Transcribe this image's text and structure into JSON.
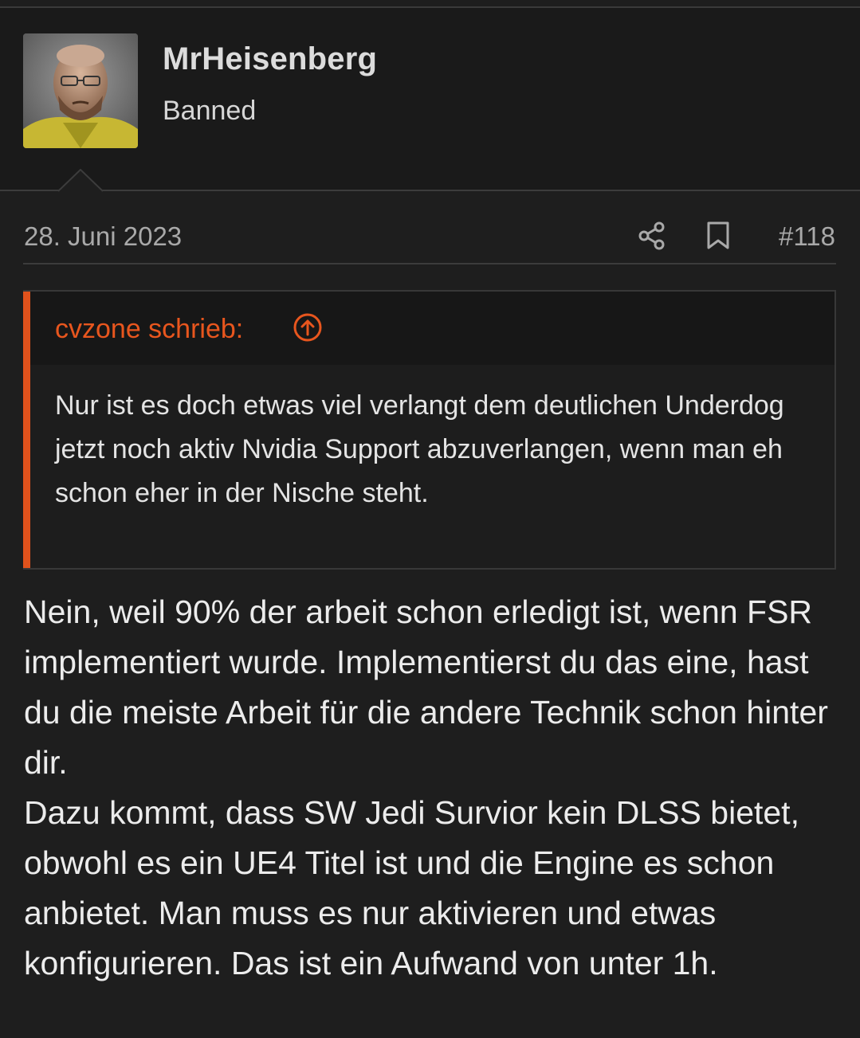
{
  "user": {
    "name": "MrHeisenberg",
    "title": "Banned",
    "avatar_icon": "portrait-avatar"
  },
  "post": {
    "date": "28. Juni 2023",
    "number": "#118",
    "share_icon": "share-icon",
    "bookmark_icon": "bookmark-icon"
  },
  "quote": {
    "author": "cvzone schrieb:",
    "jump_icon": "arrow-up-circle-icon",
    "text": "Nur ist es doch etwas viel verlangt dem deutlichen Underdog jetzt noch aktiv Nvidia Support abzuverlangen, wenn man eh schon eher in der Nische steht."
  },
  "body": {
    "paragraph1": "Nein, weil 90% der arbeit schon erledigt ist, wenn FSR implementiert wurde. Implementierst du das eine, hast du die meiste Arbeit für die andere Technik schon hinter dir.",
    "paragraph2": "Dazu kommt, dass SW Jedi Survior kein DLSS bietet, obwohl es ein UE4 Titel ist und die Engine es schon anbietet. Man muss es nur aktivieren und etwas konfigurieren. Das ist ein Aufwand von unter 1h."
  },
  "colors": {
    "background": "#1e1e1e",
    "accent": "#e0521c",
    "text": "#e6e6e6",
    "muted": "#a9a9a9"
  }
}
